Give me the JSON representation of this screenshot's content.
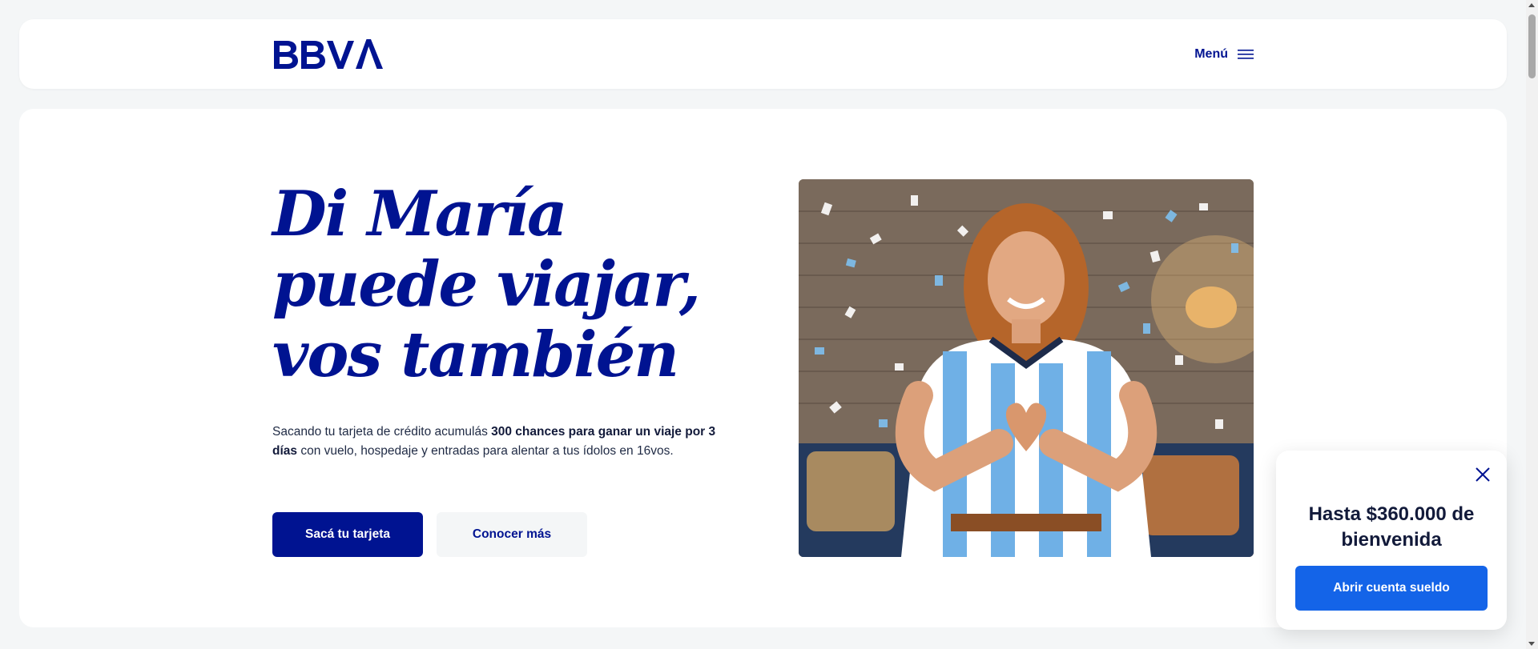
{
  "header": {
    "logo_text": "BBVA",
    "menu_label": "Menú",
    "menu_icon": "hamburger-icon"
  },
  "hero": {
    "title_lines": [
      "Di María",
      "puede viajar,",
      "vos también"
    ],
    "description": {
      "prefix": "Sacando tu tarjeta de crédito acumulás ",
      "highlight": "300 chances para ganar un viaje por 3 días",
      "suffix": " con vuelo, hospedaje y entradas para alentar a tus ídolos en 16vos."
    },
    "primary_button": "Sacá tu tarjeta",
    "secondary_button": "Conocer más",
    "image_icon": "woman-heart-hands-photo"
  },
  "popup": {
    "close_icon": "close-icon",
    "title": "Hasta $360.000 de bienvenida",
    "button": "Abrir cuenta sueldo"
  },
  "colors": {
    "brand_navy": "#001391",
    "accent_blue": "#1464e8",
    "background": "#f4f6f7",
    "card": "#ffffff"
  }
}
